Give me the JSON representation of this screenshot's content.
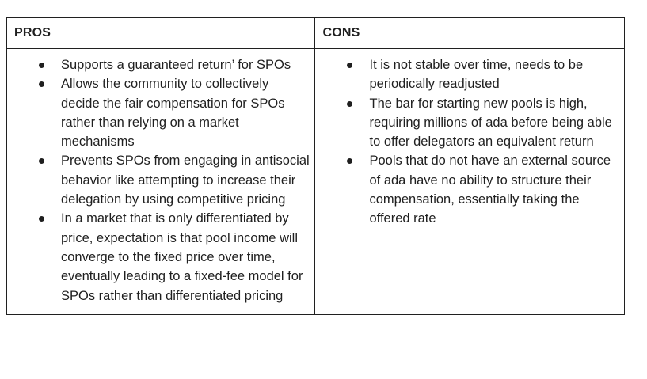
{
  "table": {
    "headers": {
      "pros": "PROS",
      "cons": "CONS"
    },
    "pros": [
      "Supports a guaranteed return’ for SPOs",
      "Allows the community to collectively decide the fair compensation for SPOs rather than relying on a market mechanisms",
      "Prevents SPOs from engaging in antisocial behavior like attempting to increase their delegation by using competitive pricing",
      "In a market that is only differentiated by price, expectation is that pool income will converge to the fixed price over time, eventually leading to a fixed-fee model for SPOs rather than differentiated pricing"
    ],
    "cons": [
      "It is not stable over time, needs to be periodically readjusted",
      "The bar for starting new pools is high, requiring millions of ada before being able to offer delegators an equivalent return",
      "Pools that do not have an external source of ada have no ability to structure their compensation, essentially taking the offered rate"
    ]
  },
  "icons": {
    "bullet": "bullet-dot-icon"
  }
}
